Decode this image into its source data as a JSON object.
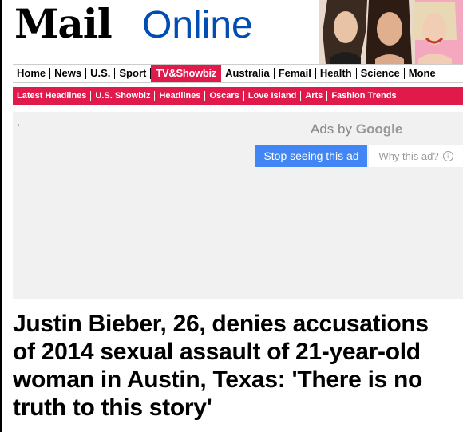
{
  "masthead": {
    "logo_mail": "Mail",
    "logo_online": "Online"
  },
  "nav": {
    "primary": [
      "Home",
      "News",
      "U.S.",
      "Sport",
      "TV&Showbiz",
      "Australia",
      "Femail",
      "Health",
      "Science",
      "Mone"
    ],
    "active": "TV&Showbiz",
    "secondary": [
      "Latest Headlines",
      "U.S. Showbiz",
      "Headlines",
      "Oscars",
      "Love Island",
      "Arts",
      "Fashion Trends"
    ]
  },
  "ad": {
    "back_arrow": "←",
    "ads_by": "Ads by",
    "google": "Google",
    "stop_label": "Stop seeing this ad",
    "why_label": "Why this ad?",
    "info_glyph": "i"
  },
  "article": {
    "headline": "Justin Bieber, 26, denies accusations of 2014 sexual assault of 21-year-old woman in Austin, Texas: 'There is no truth to this story'"
  },
  "colors": {
    "accent": "#e01b4c",
    "online_blue": "#004db3",
    "google_blue": "#4285f4",
    "ad_bg": "#f1f1f1"
  }
}
